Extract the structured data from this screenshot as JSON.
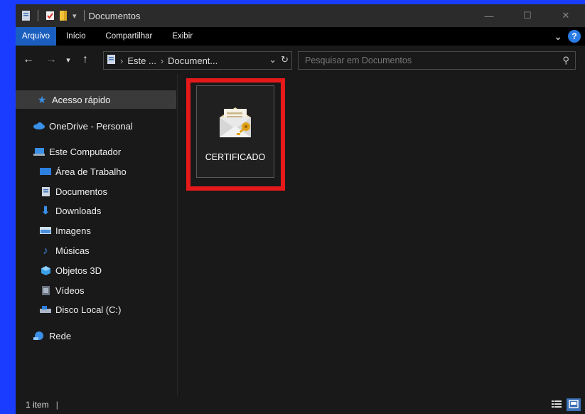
{
  "window": {
    "title": "Documentos"
  },
  "ribbon": {
    "tabs": [
      {
        "label": "Arquivo",
        "active": true
      },
      {
        "label": "Início",
        "active": false
      },
      {
        "label": "Compartilhar",
        "active": false
      },
      {
        "label": "Exibir",
        "active": false
      }
    ],
    "help_label": "?"
  },
  "address": {
    "crumbs": [
      "Este ...",
      "Document..."
    ],
    "search_placeholder": "Pesquisar em Documentos"
  },
  "sidebar": {
    "items": [
      {
        "label": "Acesso rápido",
        "icon": "star-icon",
        "selected": true
      },
      {
        "label": "OneDrive - Personal",
        "icon": "cloud-icon"
      },
      {
        "label": "Este Computador",
        "icon": "computer-icon"
      },
      {
        "label": "Área de Trabalho",
        "icon": "desktop-icon"
      },
      {
        "label": "Documentos",
        "icon": "document-icon"
      },
      {
        "label": "Downloads",
        "icon": "download-icon"
      },
      {
        "label": "Imagens",
        "icon": "image-icon"
      },
      {
        "label": "Músicas",
        "icon": "music-icon"
      },
      {
        "label": "Objetos 3D",
        "icon": "cube-icon"
      },
      {
        "label": "Vídeos",
        "icon": "video-icon"
      },
      {
        "label": "Disco Local (C:)",
        "icon": "drive-icon"
      },
      {
        "label": "Rede",
        "icon": "network-icon"
      }
    ]
  },
  "content": {
    "files": [
      {
        "name": "CERTIFICADO",
        "icon": "certificate-icon"
      }
    ]
  },
  "status": {
    "count": "1 item",
    "sep": "|"
  },
  "colors": {
    "accent": "#1a5fbf",
    "highlight": "#e5191a",
    "background": "#1a3cff"
  }
}
